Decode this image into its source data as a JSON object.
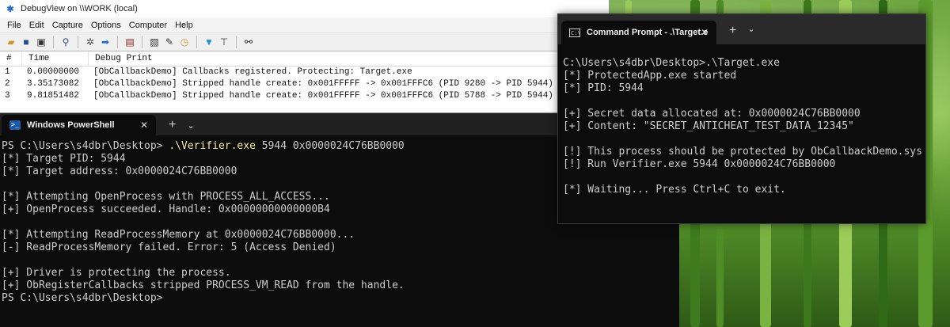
{
  "debugview": {
    "title": "DebugView on \\\\WORK (local)",
    "menu": [
      "File",
      "Edit",
      "Capture",
      "Options",
      "Computer",
      "Help"
    ],
    "columns": [
      "#",
      "Time",
      "Debug Print"
    ],
    "rows": [
      {
        "n": "1",
        "time": "0.00000000",
        "text": "[ObCallbackDemo] Callbacks registered. Protecting: Target.exe"
      },
      {
        "n": "2",
        "time": "3.35173082",
        "text": "[ObCallbackDemo] Stripped handle create: 0x001FFFFF -> 0x001FFFC6 (PID 9280 -> PID 5944)"
      },
      {
        "n": "3",
        "time": "9.81851482",
        "text": "[ObCallbackDemo] Stripped handle create: 0x001FFFFF -> 0x001FFFC6 (PID 5788 -> PID 5944)"
      }
    ],
    "toolbar_icons": [
      "open-icon",
      "save-icon",
      "clear-icon",
      "find-icon",
      "capture-icon",
      "autoscroll-icon",
      "history-icon",
      "filter-icon",
      "highlight-icon",
      "clock-icon",
      "settings-icon",
      "connect-icon",
      "search-icon"
    ]
  },
  "powershell": {
    "tab_title": "Windows PowerShell",
    "close_glyph": "✕",
    "plus_glyph": "+",
    "chevron_glyph": "⌄",
    "prompt": "PS C:\\Users\\s4dbr\\Desktop> ",
    "command_exe": ".\\Verifier.exe",
    "command_args": " 5944 0x0000024C76BB0000",
    "output": "[*] Target PID: 5944\n[*] Target address: 0x0000024C76BB0000\n\n[*] Attempting OpenProcess with PROCESS_ALL_ACCESS...\n[+] OpenProcess succeeded. Handle: 0x00000000000000B4\n\n[*] Attempting ReadProcessMemory at 0x0000024C76BB0000...\n[-] ReadProcessMemory failed. Error: 5 (Access Denied)\n\n[+] Driver is protecting the process.\n[+] ObRegisterCallbacks stripped PROCESS_VM_READ from the handle.\nPS C:\\Users\\s4dbr\\Desktop>"
  },
  "cmd": {
    "tab_title": "Command Prompt - .\\Target.e",
    "close_glyph": "✕",
    "plus_glyph": "+",
    "chevron_glyph": "⌄",
    "output": "C:\\Users\\s4dbr\\Desktop>.\\Target.exe\n[*] ProtectedApp.exe started\n[*] PID: 5944\n\n[+] Secret data allocated at: 0x0000024C76BB0000\n[+] Content: \"SECRET_ANTICHEAT_TEST_DATA_12345\"\n\n[!] This process should be protected by ObCallbackDemo.sys\n[!] Run Verifier.exe 5944 0x0000024C76BB0000\n\n[*] Waiting... Press Ctrl+C to exit."
  },
  "colors": {
    "terminal_bg": "#0c0c0c",
    "terminal_text": "#cccccc",
    "ps_command_highlight": "#f2f0a0",
    "wallpaper_green": "#6fa742"
  }
}
